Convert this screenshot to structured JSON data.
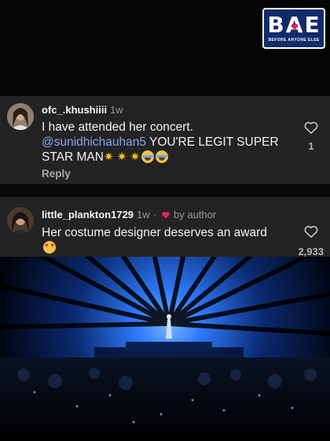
{
  "logo": {
    "letters": "BAE",
    "tagline": "BEFORE ANYONE ELSE"
  },
  "comments": [
    {
      "username": "ofc_.khushiiii",
      "time": "1w",
      "text": "I have attended her concert.",
      "mention": "@sunidhichauhan5",
      "text2": "YOU'RE LEGIT SUPER STAR MAN",
      "reply_label": "Reply",
      "likes": "1",
      "avatar_icon": "user-avatar"
    },
    {
      "username": "little_plankton1729",
      "time": "1w",
      "separator": "·",
      "author_badge": "by author",
      "text": "Her costume designer deserves an award",
      "likes": "2,933",
      "avatar_icon": "user-avatar"
    }
  ],
  "colors": {
    "card_bg": "#232325",
    "mention": "#8aa4e6",
    "heart_red": "#e0245e",
    "stage_blue": "#1e6fff"
  }
}
